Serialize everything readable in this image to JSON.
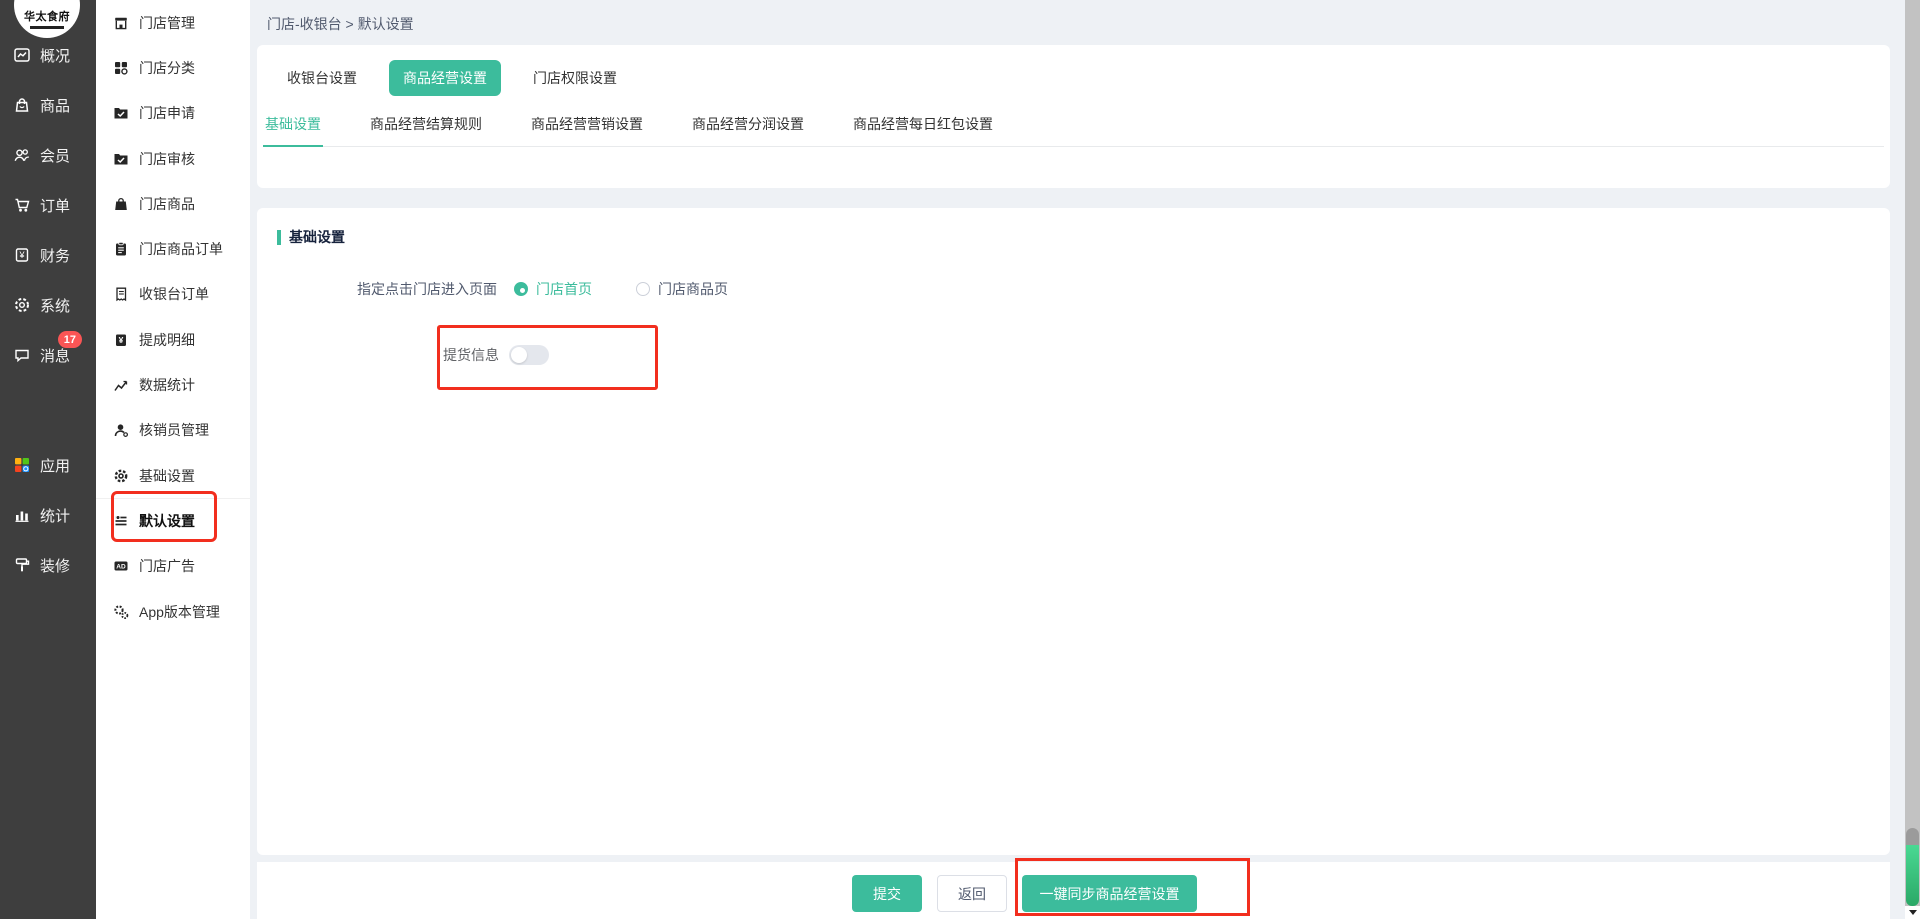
{
  "colors": {
    "accent": "#3CBC9C",
    "annotation_red": "#F22E1E",
    "badge_red": "#FA5555",
    "sidebar_bg": "#3E3E3E",
    "page_bg": "#EEF1F5",
    "scrollbar_track": "#C2C2C2",
    "scrollbar_thumb": "#35C97F"
  },
  "logo": {
    "text": "华太食府"
  },
  "left_sidebar": {
    "items": [
      {
        "icon": "overview-icon",
        "label": "概况"
      },
      {
        "icon": "goods-icon",
        "label": "商品"
      },
      {
        "icon": "member-icon",
        "label": "会员"
      },
      {
        "icon": "order-icon",
        "label": "订单"
      },
      {
        "icon": "finance-icon",
        "label": "财务"
      },
      {
        "icon": "system-icon",
        "label": "系统"
      },
      {
        "icon": "message-icon",
        "label": "消息",
        "badge": "17"
      },
      {
        "icon": "apps-icon",
        "label": "应用"
      },
      {
        "icon": "stats-icon",
        "label": "统计"
      },
      {
        "icon": "decorate-icon",
        "label": "装修"
      }
    ]
  },
  "sub_sidebar": {
    "active_item": "默认设置",
    "items": [
      {
        "icon": "store-manage-icon",
        "label": "门店管理"
      },
      {
        "icon": "store-category-icon",
        "label": "门店分类"
      },
      {
        "icon": "store-apply-icon",
        "label": "门店申请"
      },
      {
        "icon": "store-audit-icon",
        "label": "门店审核"
      },
      {
        "icon": "store-goods-icon",
        "label": "门店商品"
      },
      {
        "icon": "store-goods-order-icon",
        "label": "门店商品订单"
      },
      {
        "icon": "cashier-order-icon",
        "label": "收银台订单"
      },
      {
        "icon": "commission-icon",
        "label": "提成明细"
      },
      {
        "icon": "data-stats-icon",
        "label": "数据统计"
      },
      {
        "icon": "verifier-manage-icon",
        "label": "核销员管理"
      },
      {
        "icon": "basic-settings-icon",
        "label": "基础设置"
      },
      {
        "icon": "default-settings-icon",
        "label": "默认设置"
      },
      {
        "icon": "store-ad-icon",
        "label": "门店广告"
      },
      {
        "icon": "app-version-icon",
        "label": "App版本管理"
      }
    ]
  },
  "breadcrumb": "门店-收银台 > 默认设置",
  "tabs": {
    "active_tab": "商品经营设置",
    "items": [
      {
        "label": "收银台设置"
      },
      {
        "label": "商品经营设置"
      },
      {
        "label": "门店权限设置"
      }
    ]
  },
  "subtabs": {
    "active_subtab": "基础设置",
    "items": [
      {
        "label": "基础设置"
      },
      {
        "label": "商品经营结算规则"
      },
      {
        "label": "商品经营营销设置"
      },
      {
        "label": "商品经营分润设置"
      },
      {
        "label": "商品经营每日红包设置"
      }
    ]
  },
  "section": {
    "title": "基础设置"
  },
  "form": {
    "page_entry_label": "指定点击门店进入页面",
    "page_entry_options": [
      {
        "label": "门店首页",
        "selected": true
      },
      {
        "label": "门店商品页",
        "selected": false
      }
    ],
    "pickup_info_label": "提货信息",
    "pickup_toggle_on": false
  },
  "footer": {
    "submit_label": "提交",
    "back_label": "返回",
    "sync_label": "一键同步商品经营设置"
  }
}
